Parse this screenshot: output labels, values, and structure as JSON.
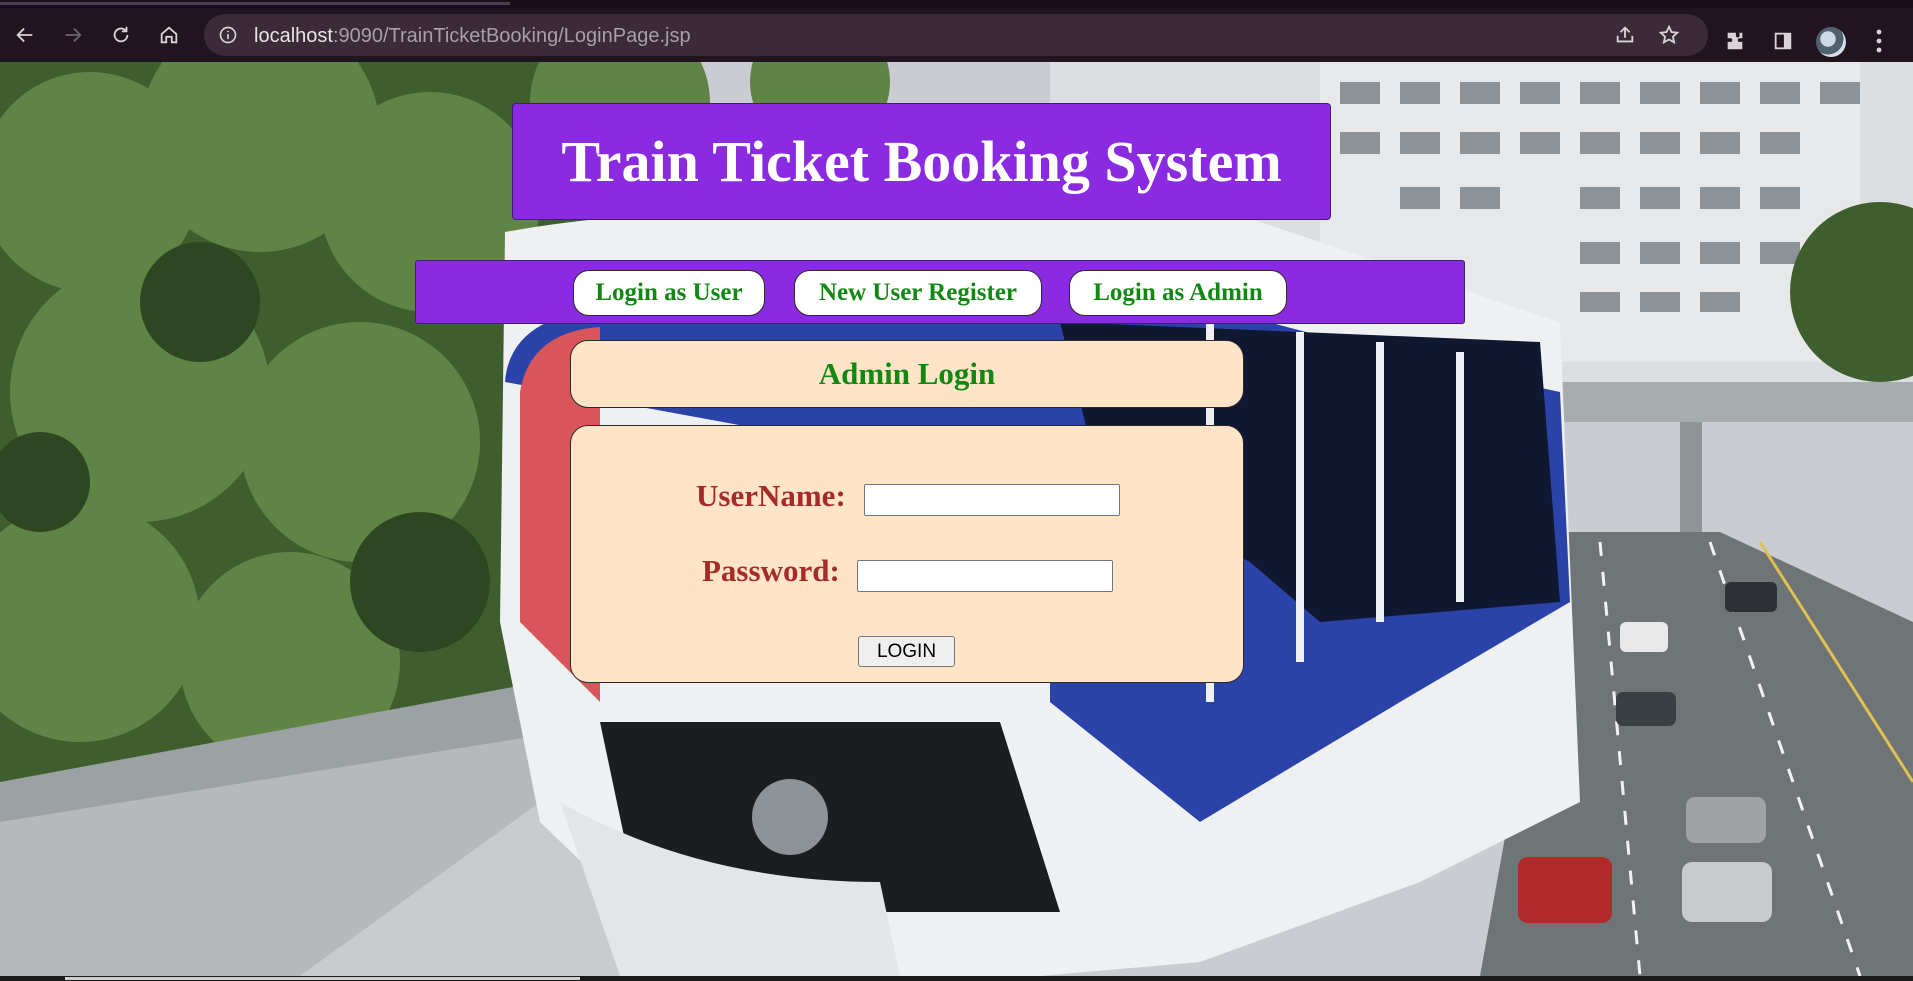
{
  "browser": {
    "url_host": "localhost",
    "url_rest": ":9090/TrainTicketBooking/LoginPage.jsp",
    "icons": [
      "back-icon",
      "forward-icon",
      "reload-icon",
      "home-icon",
      "site-info-icon",
      "share-icon",
      "bookmark-star-icon",
      "extensions-icon",
      "side-panel-icon",
      "profile-avatar",
      "menu-icon"
    ]
  },
  "page": {
    "title": "Train Ticket Booking System",
    "nav": [
      {
        "label": "Login as User"
      },
      {
        "label": "New User Register"
      },
      {
        "label": "Login as Admin"
      }
    ],
    "form_heading": "Admin Login",
    "username_label": "UserName:",
    "username_value": "",
    "password_label": "Password:",
    "password_value": "",
    "login_button": "LOGIN",
    "background_image": "monorail train on elevated track beside a city street"
  },
  "colors": {
    "banner": "#8a2be2",
    "link_text": "#118811",
    "panel": "#ffe4c8",
    "label_text": "#a52a2a"
  }
}
